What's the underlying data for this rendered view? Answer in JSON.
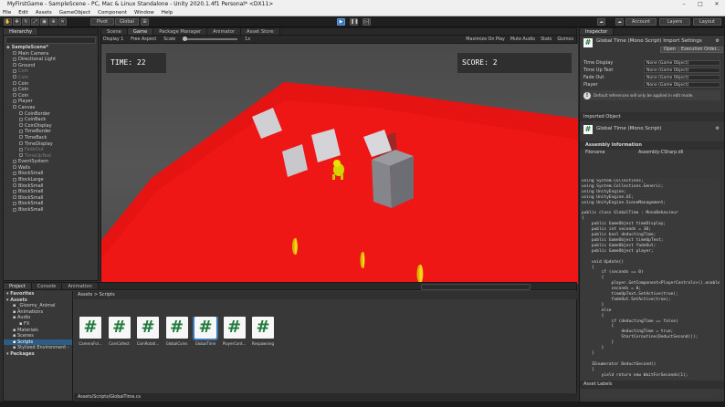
{
  "window": {
    "title": "MyFirstGame - SampleScene - PC, Mac & Linux Standalone - Unity 2020.1.4f1 Personal* <DX11>"
  },
  "menu": [
    "File",
    "Edit",
    "Assets",
    "GameObject",
    "Component",
    "Window",
    "Help"
  ],
  "toolbar": {
    "pivot": "Pivot",
    "global": "Global",
    "account": "Account",
    "layers": "Layers",
    "layout": "Layout"
  },
  "hierarchy": {
    "tab": "Hierarchy",
    "scene": "SampleScene*",
    "items": [
      {
        "label": "Main Camera",
        "depth": 1,
        "dim": false
      },
      {
        "label": "Directional Light",
        "depth": 1,
        "dim": false
      },
      {
        "label": "Ground",
        "depth": 1,
        "dim": false
      },
      {
        "label": "Coin",
        "depth": 1,
        "dim": true
      },
      {
        "label": "Coin",
        "depth": 1,
        "dim": true
      },
      {
        "label": "Coin",
        "depth": 1,
        "dim": false
      },
      {
        "label": "Coin",
        "depth": 1,
        "dim": false
      },
      {
        "label": "Coin",
        "depth": 1,
        "dim": false
      },
      {
        "label": "Player",
        "depth": 1,
        "dim": false
      },
      {
        "label": "Canvas",
        "depth": 1,
        "dim": false
      },
      {
        "label": "CoinBorder",
        "depth": 2,
        "dim": false
      },
      {
        "label": "CoinBack",
        "depth": 2,
        "dim": false
      },
      {
        "label": "CoinDisplay",
        "depth": 2,
        "dim": false
      },
      {
        "label": "TimeBorder",
        "depth": 2,
        "dim": false
      },
      {
        "label": "TimeBack",
        "depth": 2,
        "dim": false
      },
      {
        "label": "TimeDisplay",
        "depth": 2,
        "dim": false
      },
      {
        "label": "FadeOut",
        "depth": 2,
        "dim": true
      },
      {
        "label": "TimeUpText",
        "depth": 2,
        "dim": true
      },
      {
        "label": "EventSystem",
        "depth": 1,
        "dim": false
      },
      {
        "label": "Walls",
        "depth": 1,
        "dim": false
      },
      {
        "label": "BlockSmall",
        "depth": 1,
        "dim": false
      },
      {
        "label": "BlockLarge",
        "depth": 1,
        "dim": false
      },
      {
        "label": "BlockSmall",
        "depth": 1,
        "dim": false
      },
      {
        "label": "BlockSmall",
        "depth": 1,
        "dim": false
      },
      {
        "label": "BlockSmall",
        "depth": 1,
        "dim": false
      },
      {
        "label": "BlockSmall",
        "depth": 1,
        "dim": false
      },
      {
        "label": "BlockSmall",
        "depth": 1,
        "dim": false
      }
    ]
  },
  "center_tabs": [
    "Scene",
    "Game",
    "Package Manager",
    "Animator",
    "Asset Store"
  ],
  "gamebar": {
    "display": "Display 1",
    "aspect": "Free Aspect",
    "scale_label": "Scale",
    "scale_value": "1x",
    "maximize": "Maximize On Play",
    "mute": "Mute Audio",
    "stats": "Stats",
    "gizmos": "Gizmos"
  },
  "game": {
    "time_text": "TIME: 22",
    "score_text": "SCORE: 2"
  },
  "inspector": {
    "tab": "Inspector",
    "title": "Global Time (Mono Script) Import Settings",
    "open": "Open",
    "exec_order": "Execution Order...",
    "fields": [
      {
        "label": "Time Display",
        "value": "None (Game Object)"
      },
      {
        "label": "Time Up Text",
        "value": "None (Game Object)"
      },
      {
        "label": "Fade Out",
        "value": "None (Game Object)"
      },
      {
        "label": "Player",
        "value": "None (Game Object)"
      }
    ],
    "note": "Default references will only be applied in edit mode.",
    "imported_object": "Imported Object",
    "script_title": "Global Time (Mono Script)",
    "assembly_info": "Assembly Information",
    "filename_label": "Filename",
    "filename_value": "Assembly-CSharp.dll",
    "code": "using System.Collections;\nusing System.Collections.Generic;\nusing UnityEngine;\nusing UnityEngine.UI;\nusing UnityEngine.SceneManagement;\n\npublic class GlobalTime : MonoBehaviour\n{\n    public GameObject timeDisplay;\n    public int seconds = 30;\n    public bool deductingTime;\n    public GameObject timeUpText;\n    public GameObject fadeOut;\n    public GameObject player;\n\n    void Update()\n    {\n        if (seconds == 0)\n        {\n            player.GetComponent<PlayerControls>().enabled = false;\n            seconds = 0;\n            timeUpText.SetActive(true);\n            fadeOut.SetActive(true);\n        }\n        else\n        {\n            if (deductingTime == false)\n            {\n                deductingTime = true;\n                StartCoroutine(DeductSecond());\n            }\n        }\n    }\n\n    IEnumerator DeductSecond()\n    {\n        yield return new WaitForSeconds(1);",
    "asset_labels": "Asset Labels"
  },
  "project": {
    "tabs": [
      "Project",
      "Console",
      "Animation"
    ],
    "tree": [
      {
        "label": "Favorites",
        "bold": true,
        "depth": 0,
        "sel": false
      },
      {
        "label": "Assets",
        "bold": true,
        "depth": 0,
        "sel": false
      },
      {
        "label": "_Gloomy_Animal",
        "bold": false,
        "depth": 1,
        "sel": false
      },
      {
        "label": "Animations",
        "bold": false,
        "depth": 1,
        "sel": false
      },
      {
        "label": "Audio",
        "bold": false,
        "depth": 1,
        "sel": false
      },
      {
        "label": "FX",
        "bold": false,
        "depth": 2,
        "sel": false
      },
      {
        "label": "Materials",
        "bold": false,
        "depth": 1,
        "sel": false
      },
      {
        "label": "Scenes",
        "bold": false,
        "depth": 1,
        "sel": false
      },
      {
        "label": "Scripts",
        "bold": false,
        "depth": 1,
        "sel": true
      },
      {
        "label": "Stylized Environment -",
        "bold": false,
        "depth": 1,
        "sel": false
      },
      {
        "label": "Packages",
        "bold": true,
        "depth": 0,
        "sel": false
      }
    ],
    "breadcrumb": "Assets > Scripts",
    "assets": [
      "CameraFol...",
      "CoinCollect",
      "CoinRotati...",
      "GlobalCoins",
      "GlobalTime",
      "PlayerCont...",
      "Respawning"
    ],
    "selected_asset": 4,
    "path": "Assets/Scripts/GlobalTime.cs"
  },
  "colors": {
    "ground": "#f01010",
    "selected": "#3b78b8",
    "script_icon": "#1e7a3a"
  }
}
